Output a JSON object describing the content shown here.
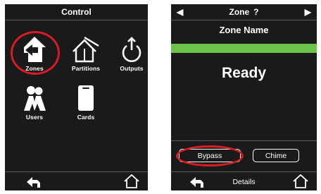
{
  "left": {
    "title": "Control",
    "tiles": [
      {
        "label": "Zones",
        "icon": "house-arrow-icon"
      },
      {
        "label": "Partitions",
        "icon": "partitions-icon"
      },
      {
        "label": "Outputs",
        "icon": "power-icon"
      },
      {
        "label": "Users",
        "icon": "users-icon"
      },
      {
        "label": "Cards",
        "icon": "card-icon"
      }
    ],
    "highlighted_tile": "Zones"
  },
  "right": {
    "title": "Zone",
    "title_suffix": "?",
    "zone_name": "Zone Name",
    "status": "Ready",
    "status_color": "#6cc24a",
    "buttons": {
      "bypass": "Bypass",
      "chime": "Chime"
    },
    "details_label": "Details",
    "highlighted_button": "Bypass"
  },
  "colors": {
    "screen_bg": "#1a1a1a",
    "highlight": "#d81c24",
    "ready_bar": "#6cc24a"
  }
}
